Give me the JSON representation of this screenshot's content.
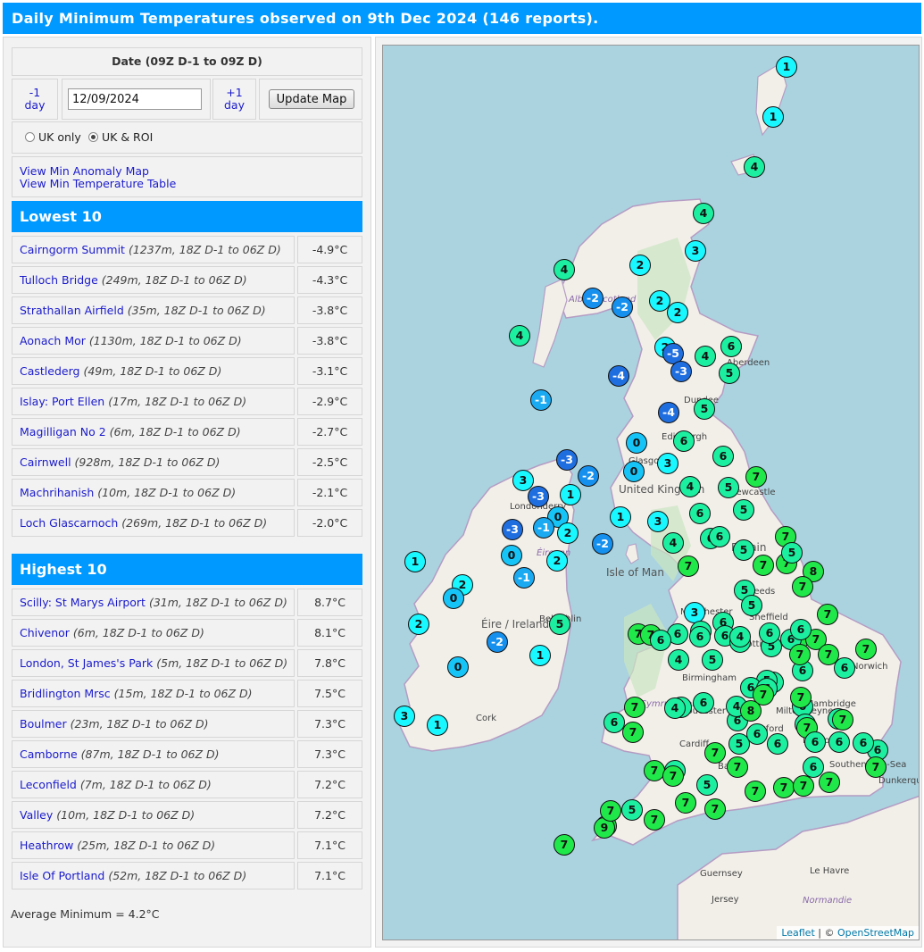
{
  "title": "Daily Minimum Temperatures observed on 9th Dec 2024 (146 reports).",
  "date_header": "Date (09Z D-1 to 09Z D)",
  "prev_day": "-1\nday",
  "next_day": "+1\nday",
  "prev_day_label": "-1",
  "prev_day_unit": "day",
  "next_day_label": "+1",
  "next_day_unit": "day",
  "date_value": "12/09/2024",
  "update_button": "Update Map",
  "region": {
    "uk_only": "UK only",
    "uk_roi": "UK & ROI",
    "selected": "UK & ROI"
  },
  "links": {
    "anomaly": "View Min Anomaly Map",
    "table": "View Min Temperature Table"
  },
  "lowest_heading": "Lowest 10",
  "highest_heading": "Highest 10",
  "lowest": [
    {
      "station": "Cairngorm Summit",
      "detail": "(1237m, 18Z D-1 to 06Z D)",
      "value": "-4.9°C"
    },
    {
      "station": "Tulloch Bridge",
      "detail": "(249m, 18Z D-1 to 06Z D)",
      "value": "-4.3°C"
    },
    {
      "station": "Strathallan Airfield",
      "detail": "(35m, 18Z D-1 to 06Z D)",
      "value": "-3.8°C"
    },
    {
      "station": "Aonach Mor",
      "detail": "(1130m, 18Z D-1 to 06Z D)",
      "value": "-3.8°C"
    },
    {
      "station": "Castlederg",
      "detail": "(49m, 18Z D-1 to 06Z D)",
      "value": "-3.1°C"
    },
    {
      "station": "Islay: Port Ellen",
      "detail": "(17m, 18Z D-1 to 06Z D)",
      "value": "-2.9°C"
    },
    {
      "station": "Magilligan No 2",
      "detail": "(6m, 18Z D-1 to 06Z D)",
      "value": "-2.7°C"
    },
    {
      "station": "Cairnwell",
      "detail": "(928m, 18Z D-1 to 06Z D)",
      "value": "-2.5°C"
    },
    {
      "station": "Machrihanish",
      "detail": "(10m, 18Z D-1 to 06Z D)",
      "value": "-2.1°C"
    },
    {
      "station": "Loch Glascarnoch",
      "detail": "(269m, 18Z D-1 to 06Z D)",
      "value": "-2.0°C"
    }
  ],
  "highest": [
    {
      "station": "Scilly: St Marys Airport",
      "detail": "(31m, 18Z D-1 to 06Z D)",
      "value": "8.7°C"
    },
    {
      "station": "Chivenor",
      "detail": "(6m, 18Z D-1 to 06Z D)",
      "value": "8.1°C"
    },
    {
      "station": "London, St James's Park",
      "detail": "(5m, 18Z D-1 to 06Z D)",
      "value": "7.8°C"
    },
    {
      "station": "Bridlington Mrsc",
      "detail": "(15m, 18Z D-1 to 06Z D)",
      "value": "7.5°C"
    },
    {
      "station": "Boulmer",
      "detail": "(23m, 18Z D-1 to 06Z D)",
      "value": "7.3°C"
    },
    {
      "station": "Camborne",
      "detail": "(87m, 18Z D-1 to 06Z D)",
      "value": "7.3°C"
    },
    {
      "station": "Leconfield",
      "detail": "(7m, 18Z D-1 to 06Z D)",
      "value": "7.2°C"
    },
    {
      "station": "Valley",
      "detail": "(10m, 18Z D-1 to 06Z D)",
      "value": "7.2°C"
    },
    {
      "station": "Heathrow",
      "detail": "(25m, 18Z D-1 to 06Z D)",
      "value": "7.1°C"
    },
    {
      "station": "Isle Of Portland",
      "detail": "(52m, 18Z D-1 to 06Z D)",
      "value": "7.1°C"
    }
  ],
  "average": "Average Minimum = 4.2°C",
  "map_labels": [
    "Aberdeen",
    "Dundee",
    "Edinburgh",
    "Glasgow",
    "United Kingdom",
    "Newcastle",
    "Britain",
    "Isle of Man",
    "Londonderry",
    "Éireann",
    "Belfast",
    "Éire / Ireland",
    "Dublin",
    "Cork",
    "Leeds",
    "Sheffield",
    "Hull",
    "Manchester",
    "Nottingham",
    "Birmingham",
    "Norwich",
    "Milton Keynes",
    "Cambridge",
    "Gloucester",
    "Oxford",
    "Cardiff",
    "Bath",
    "London",
    "Southend-on-Sea",
    "Dunkerque",
    "Guernsey",
    "Jersey",
    "Le Havre",
    "Normandie",
    "Alba / Scotland",
    "Cymru / Wales"
  ],
  "attribution": {
    "leaflet": "Leaflet",
    "sep": " | © ",
    "osm": "OpenStreetMap"
  },
  "markers": [
    {
      "v": 1,
      "c": "#19f7ff"
    },
    {
      "v": 1,
      "c": "#19f7ff"
    },
    {
      "v": 4,
      "c": "#1cf0a0"
    },
    {
      "v": 4,
      "c": "#1cf0a0"
    },
    {
      "v": 3,
      "c": "#19f7ff"
    },
    {
      "v": 2,
      "c": "#19f7ff"
    },
    {
      "v": 4,
      "c": "#1cf0a0"
    },
    {
      "v": -2,
      "c": "#1590ee"
    },
    {
      "v": -2,
      "c": "#1590ee"
    },
    {
      "v": 2,
      "c": "#19f7ff"
    },
    {
      "v": 2,
      "c": "#19f7ff"
    },
    {
      "v": 4,
      "c": "#1cf0a0"
    },
    {
      "v": 2,
      "c": "#19f7ff"
    },
    {
      "v": -5,
      "c": "#1f6ee0"
    },
    {
      "v": 4,
      "c": "#1cf0a0"
    },
    {
      "v": 6,
      "c": "#1cf0a0"
    },
    {
      "v": -4,
      "c": "#1f6ee0"
    },
    {
      "v": -3,
      "c": "#1f6ee0"
    },
    {
      "v": 5,
      "c": "#1cf0a0"
    },
    {
      "v": -1,
      "c": "#1aaaf2"
    },
    {
      "v": -4,
      "c": "#1f6ee0"
    },
    {
      "v": 5,
      "c": "#1cf0a0"
    },
    {
      "v": 0,
      "c": "#17c4f7"
    },
    {
      "v": 6,
      "c": "#1cf0a0"
    },
    {
      "v": -3,
      "c": "#1f6ee0"
    },
    {
      "v": 0,
      "c": "#17c4f7"
    },
    {
      "v": 3,
      "c": "#19f7ff"
    },
    {
      "v": -2,
      "c": "#1590ee"
    },
    {
      "v": 6,
      "c": "#1cf0a0"
    },
    {
      "v": 7,
      "c": "#20e84a"
    },
    {
      "v": 3,
      "c": "#19f7ff"
    },
    {
      "v": -3,
      "c": "#1f6ee0"
    },
    {
      "v": 1,
      "c": "#19f7ff"
    },
    {
      "v": 0,
      "c": "#17c4f7"
    },
    {
      "v": 4,
      "c": "#1cf0a0"
    },
    {
      "v": 5,
      "c": "#1cf0a0"
    },
    {
      "v": -3,
      "c": "#1f6ee0"
    },
    {
      "v": -1,
      "c": "#1aaaf2"
    },
    {
      "v": 2,
      "c": "#19f7ff"
    },
    {
      "v": 1,
      "c": "#19f7ff"
    },
    {
      "v": 3,
      "c": "#19f7ff"
    },
    {
      "v": 6,
      "c": "#1cf0a0"
    },
    {
      "v": 5,
      "c": "#1cf0a0"
    },
    {
      "v": -2,
      "c": "#1590ee"
    },
    {
      "v": 0,
      "c": "#17c4f7"
    },
    {
      "v": 4,
      "c": "#1cf0a0"
    },
    {
      "v": 6,
      "c": "#1cf0a0"
    },
    {
      "v": 5,
      "c": "#1cf0a0"
    },
    {
      "v": 6,
      "c": "#1cf0a0"
    },
    {
      "v": 7,
      "c": "#20e84a"
    },
    {
      "v": 1,
      "c": "#19f7ff"
    },
    {
      "v": -1,
      "c": "#1aaaf2"
    },
    {
      "v": 2,
      "c": "#19f7ff"
    },
    {
      "v": 7,
      "c": "#20e84a"
    },
    {
      "v": 7,
      "c": "#20e84a"
    },
    {
      "v": 5,
      "c": "#1cf0a0"
    },
    {
      "v": 8,
      "c": "#20e84a"
    },
    {
      "v": 2,
      "c": "#19f7ff"
    },
    {
      "v": 0,
      "c": "#17c4f7"
    },
    {
      "v": 7,
      "c": "#20e84a"
    },
    {
      "v": 5,
      "c": "#1cf0a0"
    },
    {
      "v": 5,
      "c": "#1cf0a0"
    },
    {
      "v": 7,
      "c": "#20e84a"
    },
    {
      "v": 2,
      "c": "#19f7ff"
    },
    {
      "v": 5,
      "c": "#1cf0a0"
    },
    {
      "v": 3,
      "c": "#19f7ff"
    },
    {
      "v": 6,
      "c": "#1cf0a0"
    },
    {
      "v": 7,
      "c": "#20e84a"
    },
    {
      "v": 7,
      "c": "#20e84a"
    },
    {
      "v": 6,
      "c": "#1cf0a0"
    },
    {
      "v": 6,
      "c": "#1cf0a0"
    },
    {
      "v": 6,
      "c": "#1cf0a0"
    },
    {
      "v": 4,
      "c": "#1cf0a0"
    },
    {
      "v": 5,
      "c": "#1cf0a0"
    },
    {
      "v": 6,
      "c": "#1cf0a0"
    },
    {
      "v": 7,
      "c": "#20e84a"
    },
    {
      "v": 7,
      "c": "#20e84a"
    },
    {
      "v": 7,
      "c": "#20e84a"
    },
    {
      "v": 6,
      "c": "#1cf0a0"
    },
    {
      "v": -2,
      "c": "#1590ee"
    },
    {
      "v": 6,
      "c": "#1cf0a0"
    },
    {
      "v": 4,
      "c": "#1cf0a0"
    },
    {
      "v": 5,
      "c": "#1cf0a0"
    },
    {
      "v": 6,
      "c": "#1cf0a0"
    },
    {
      "v": 0,
      "c": "#17c4f7"
    },
    {
      "v": 1,
      "c": "#19f7ff"
    },
    {
      "v": 7,
      "c": "#20e84a"
    },
    {
      "v": 6,
      "c": "#1cf0a0"
    },
    {
      "v": 6,
      "c": "#1cf0a0"
    },
    {
      "v": 7,
      "c": "#20e84a"
    },
    {
      "v": 6,
      "c": "#1cf0a0"
    },
    {
      "v": 7,
      "c": "#20e84a"
    },
    {
      "v": 6,
      "c": "#1cf0a0"
    },
    {
      "v": 6,
      "c": "#1cf0a0"
    },
    {
      "v": 5,
      "c": "#1cf0a0"
    },
    {
      "v": 6,
      "c": "#1cf0a0"
    },
    {
      "v": 3,
      "c": "#19f7ff"
    },
    {
      "v": 1,
      "c": "#19f7ff"
    },
    {
      "v": 4,
      "c": "#1cf0a0"
    },
    {
      "v": 7,
      "c": "#20e84a"
    },
    {
      "v": 4,
      "c": "#1cf0a0"
    },
    {
      "v": 6,
      "c": "#1cf0a0"
    },
    {
      "v": 6,
      "c": "#1cf0a0"
    },
    {
      "v": 7,
      "c": "#20e84a"
    },
    {
      "v": 6,
      "c": "#1cf0a0"
    },
    {
      "v": 6,
      "c": "#1cf0a0"
    },
    {
      "v": 6,
      "c": "#1cf0a0"
    },
    {
      "v": 6,
      "c": "#1cf0a0"
    },
    {
      "v": 4,
      "c": "#1cf0a0"
    },
    {
      "v": 6,
      "c": "#1cf0a0"
    },
    {
      "v": 7,
      "c": "#20e84a"
    },
    {
      "v": 5,
      "c": "#1cf0a0"
    },
    {
      "v": 6,
      "c": "#1cf0a0"
    },
    {
      "v": 6,
      "c": "#1cf0a0"
    },
    {
      "v": 7,
      "c": "#20e84a"
    },
    {
      "v": 6,
      "c": "#1cf0a0"
    },
    {
      "v": 7,
      "c": "#20e84a"
    },
    {
      "v": 6,
      "c": "#1cf0a0"
    },
    {
      "v": 7,
      "c": "#20e84a"
    },
    {
      "v": 6,
      "c": "#1cf0a0"
    },
    {
      "v": 8,
      "c": "#20e84a"
    },
    {
      "v": 5,
      "c": "#1cf0a0"
    },
    {
      "v": 7,
      "c": "#20e84a"
    },
    {
      "v": 6,
      "c": "#1cf0a0"
    },
    {
      "v": 6,
      "c": "#1cf0a0"
    },
    {
      "v": 6,
      "c": "#1cf0a0"
    },
    {
      "v": 7,
      "c": "#20e84a"
    },
    {
      "v": 7,
      "c": "#20e84a"
    },
    {
      "v": 7,
      "c": "#20e84a"
    },
    {
      "v": 7,
      "c": "#20e84a"
    },
    {
      "v": 7,
      "c": "#20e84a"
    },
    {
      "v": 7,
      "c": "#20e84a"
    },
    {
      "v": 7,
      "c": "#20e84a"
    },
    {
      "v": 5,
      "c": "#1cf0a0"
    },
    {
      "v": 7,
      "c": "#20e84a"
    },
    {
      "v": 7,
      "c": "#20e84a"
    },
    {
      "v": 7,
      "c": "#20e84a"
    },
    {
      "v": 7,
      "c": "#20e84a"
    },
    {
      "v": 7,
      "c": "#20e84a"
    },
    {
      "v": 9,
      "c": "#20e84a"
    },
    {
      "v": 7,
      "c": "#20e84a"
    },
    {
      "v": 7,
      "c": "#20e84a"
    }
  ]
}
